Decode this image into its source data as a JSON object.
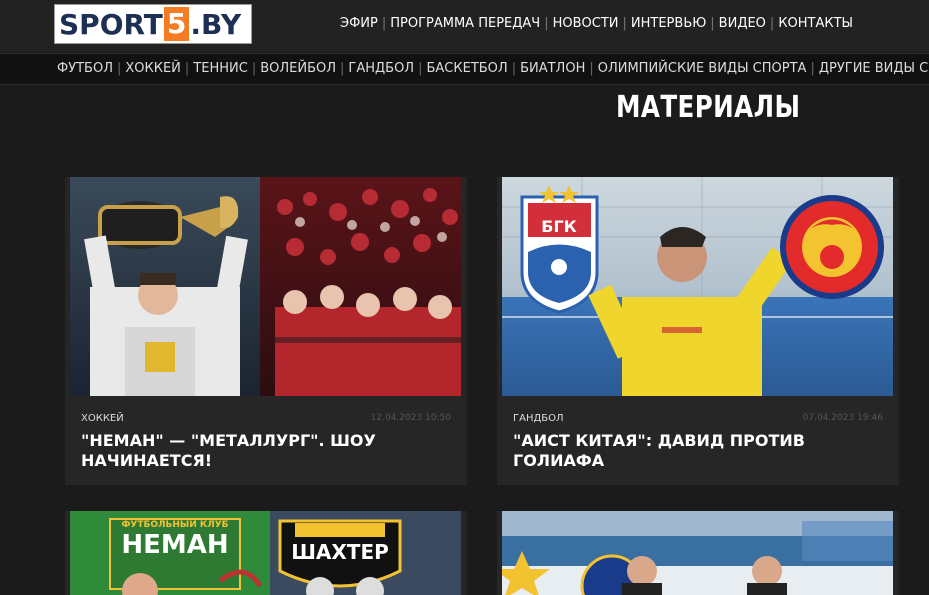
{
  "logo": {
    "part1": "SPORT",
    "part2": "5",
    "part3": ".BY"
  },
  "top_nav": [
    "ЭФИР",
    "ПРОГРАММА ПЕРЕДАЧ",
    "НОВОСТИ",
    "ИНТЕРВЬЮ",
    "ВИДЕО",
    "КОНТАКТЫ"
  ],
  "category_nav": [
    "ФУТБОЛ",
    "ХОККЕЙ",
    "ТЕННИС",
    "ВОЛЕЙБОЛ",
    "ГАНДБОЛ",
    "БАСКЕТБОЛ",
    "БИАТЛОН",
    "ОЛИМПИЙСКИЕ ВИДЫ СПОРТА",
    "ДРУГИЕ ВИДЫ СПОРТА"
  ],
  "page": {
    "heading": "МАТЕРИАЛЫ"
  },
  "articles": [
    {
      "category": "ХОККЕЙ",
      "date": "12.04.2023 10:50",
      "title": "\"НЕМАН\" — \"МЕТАЛЛУРГ\". ШОУ НАЧИНАЕТСЯ!"
    },
    {
      "category": "ГАНДБОЛ",
      "date": "07.04.2023 19:46",
      "title": "\"АИСТ КИТАЯ\": ДАВИД ПРОТИВ ГОЛИАФА"
    }
  ],
  "image_text": {
    "bgk": "БГК",
    "neman_club": "ФУТБОЛЬНЫЙ КЛУБ",
    "neman": "НЕМАН",
    "shakhter": "ШАХТЕР"
  },
  "colors": {
    "accent": "#f57c22",
    "logo_text": "#1e2f55",
    "background": "#1b1b1b",
    "card": "#262626"
  }
}
